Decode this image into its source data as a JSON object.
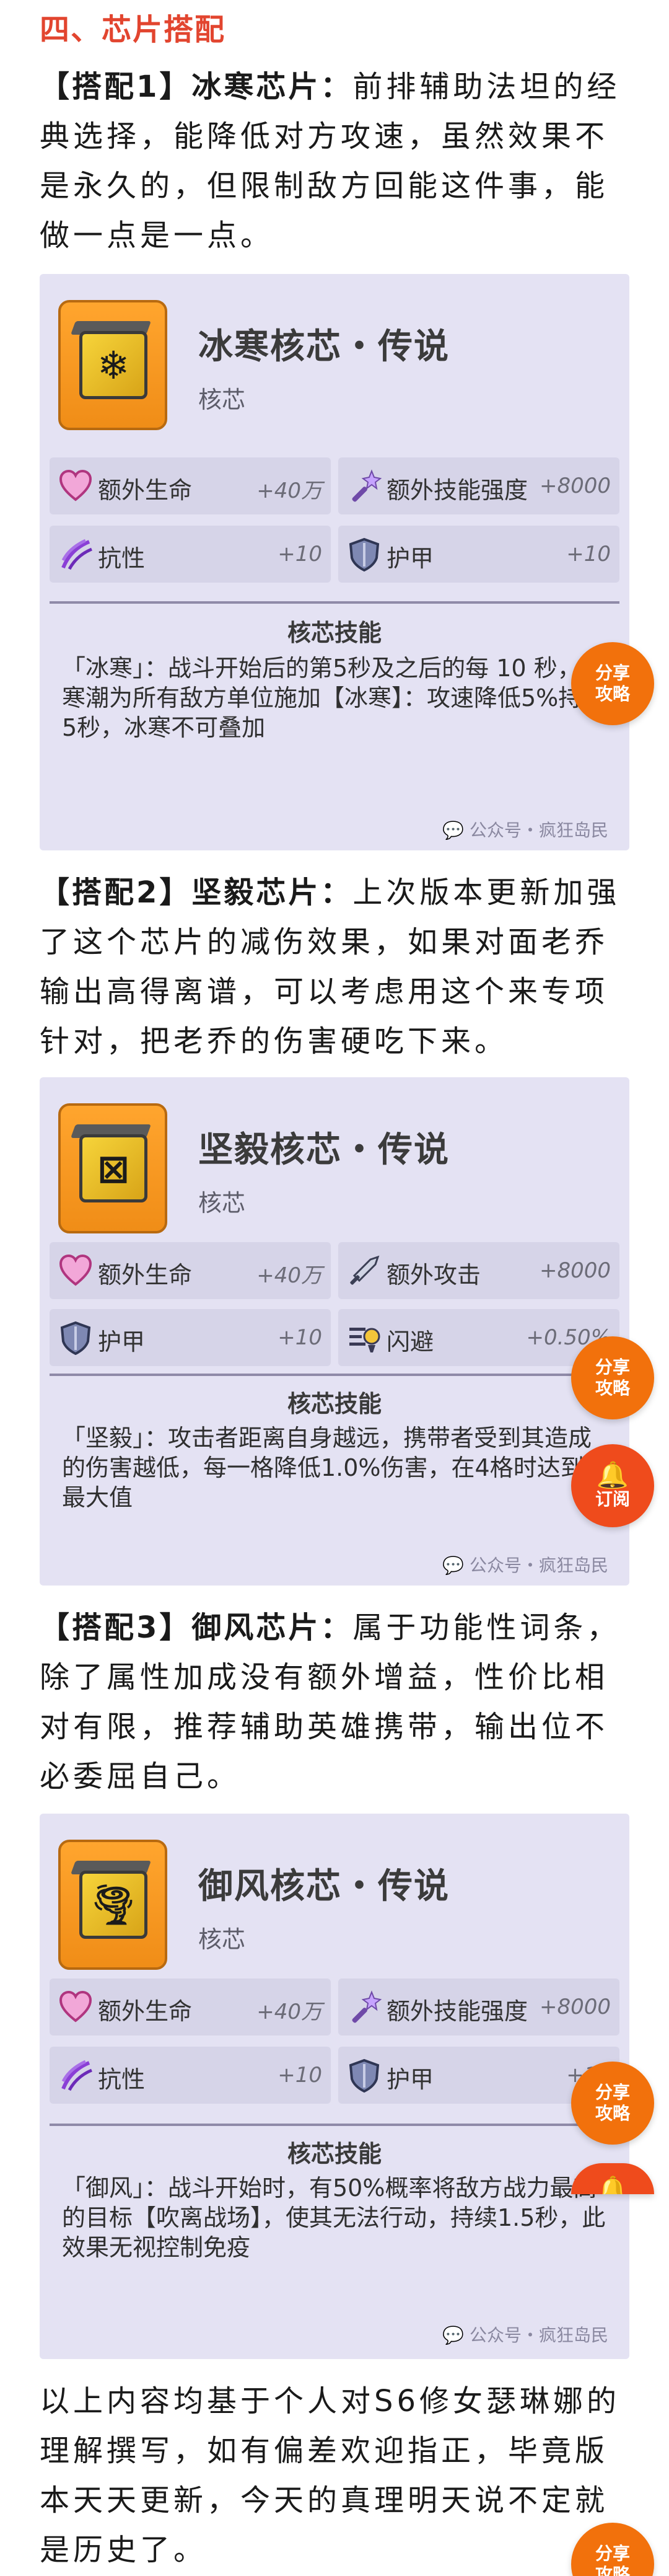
{
  "section": {
    "title": "四、芯片搭配"
  },
  "paragraphs": [
    {
      "lead": "【搭配1】冰寒芯片：",
      "body": "前排辅助法坦的经典选择，能降低对方攻速，虽然效果不是永久的，但限制敌方回能这件事，能做一点是一点。"
    },
    {
      "lead": "【搭配2】坚毅芯片：",
      "body": "上次版本更新加强了这个芯片的减伤效果，如果对面老乔输出高得离谱，可以考虑用这个来专项针对，把老乔的伤害硬吃下来。"
    },
    {
      "lead": "【搭配3】御风芯片：",
      "body": "属于功能性词条，除了属性加成没有额外增益，性价比相对有限，推荐辅助英雄携带，输出位不必委屈自己。"
    },
    {
      "lead": "",
      "body": "以上内容均基于个人对S6修女瑟琳娜的理解撰写，如有偏差欢迎指正，毕竟版本天天更新，今天的真理明天说不定就是历史了。"
    }
  ],
  "cards": [
    {
      "name": "冰寒核芯・传说",
      "type": "核芯",
      "chip_icon": "snowflake-icon",
      "chip_glyph": "❄",
      "stats": [
        {
          "icon": "heart-icon",
          "label": "额外生命",
          "value": "+40万"
        },
        {
          "icon": "magic-wand-icon",
          "label": "额外技能强度",
          "value": "+8000"
        },
        {
          "icon": "claw-resist-icon",
          "label": "抗性",
          "value": "+10"
        },
        {
          "icon": "shield-icon",
          "label": "护甲",
          "value": "+10"
        }
      ],
      "skill_title": "核芯技能",
      "skill_text": "「冰寒」：战斗开始后的第5秒及之后的每 10 秒，发寒潮为所有敌方单位施加【冰寒】：攻速降低5%持续5秒，冰寒不可叠加",
      "watermark": "公众号・疯狂岛民"
    },
    {
      "name": "坚毅核芯・传说",
      "type": "核芯",
      "chip_icon": "cross-box-icon",
      "chip_glyph": "⊠",
      "stats": [
        {
          "icon": "heart-icon",
          "label": "额外生命",
          "value": "+40万"
        },
        {
          "icon": "sword-icon",
          "label": "额外攻击",
          "value": "+8000"
        },
        {
          "icon": "shield-icon",
          "label": "护甲",
          "value": "+10"
        },
        {
          "icon": "dodge-icon",
          "label": "闪避",
          "value": "+0.50%"
        }
      ],
      "skill_title": "核芯技能",
      "skill_text": "「坚毅」：攻击者距离自身越远，携带者受到其造成的伤害越低，每一格降低1.0%伤害，在4格时达到最大值",
      "watermark": "公众号・疯狂岛民"
    },
    {
      "name": "御风核芯・传说",
      "type": "核芯",
      "chip_icon": "tornado-icon",
      "chip_glyph": "🌪",
      "stats": [
        {
          "icon": "heart-icon",
          "label": "额外生命",
          "value": "+40万"
        },
        {
          "icon": "magic-wand-icon",
          "label": "额外技能强度",
          "value": "+8000"
        },
        {
          "icon": "claw-resist-icon",
          "label": "抗性",
          "value": "+10"
        },
        {
          "icon": "shield-icon",
          "label": "护甲",
          "value": "+10"
        }
      ],
      "skill_title": "核芯技能",
      "skill_text": "「御风」：战斗开始时，有50%概率将敌方战力最高的目标【吹离战场】，使其无法行动，持续1.5秒，此效果无视控制免疫",
      "watermark": "公众号・疯狂岛民"
    }
  ],
  "floating": {
    "share_line1": "分享",
    "share_line2": "攻略",
    "subscribe_label": "订阅"
  },
  "colors": {
    "accent_red": "#e2452f",
    "float_orange": "#f2710c",
    "card_bg": "#e4e2f3",
    "stat_bg": "#d6d4e8"
  }
}
